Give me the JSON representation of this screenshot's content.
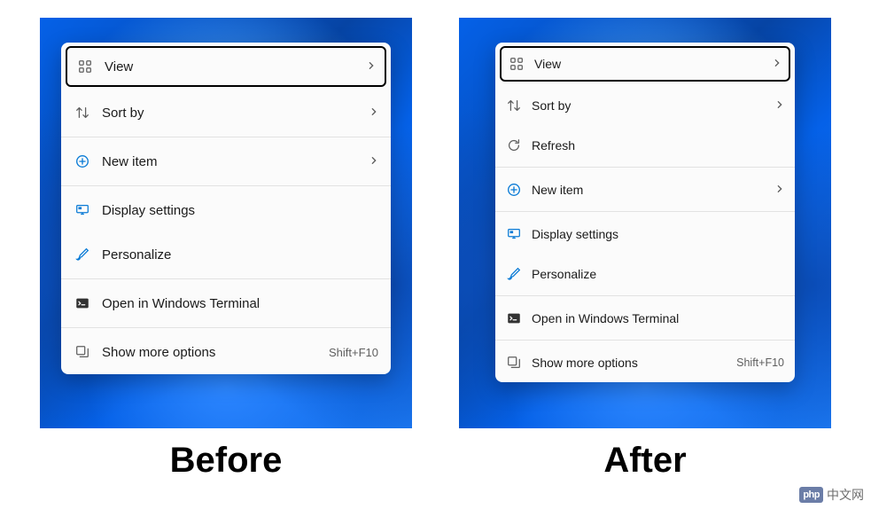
{
  "captions": {
    "before": "Before",
    "after": "After"
  },
  "shortcut": "Shift+F10",
  "before_menu": [
    {
      "type": "item",
      "icon": "grid",
      "label": "View",
      "chevron": true,
      "focused": true
    },
    {
      "type": "item",
      "icon": "sort",
      "label": "Sort by",
      "chevron": true
    },
    {
      "type": "sep"
    },
    {
      "type": "item",
      "icon": "new",
      "label": "New item",
      "chevron": true
    },
    {
      "type": "sep"
    },
    {
      "type": "item",
      "icon": "display",
      "label": "Display settings"
    },
    {
      "type": "item",
      "icon": "brush",
      "label": "Personalize"
    },
    {
      "type": "sep"
    },
    {
      "type": "item",
      "icon": "terminal",
      "label": "Open in Windows Terminal"
    },
    {
      "type": "sep"
    },
    {
      "type": "item",
      "icon": "more",
      "label": "Show more options",
      "shortcut": true
    }
  ],
  "after_menu": [
    {
      "type": "item",
      "icon": "grid",
      "label": "View",
      "chevron": true,
      "focused": true
    },
    {
      "type": "item",
      "icon": "sort",
      "label": "Sort by",
      "chevron": true
    },
    {
      "type": "item",
      "icon": "refresh",
      "label": "Refresh"
    },
    {
      "type": "sep"
    },
    {
      "type": "item",
      "icon": "new",
      "label": "New item",
      "chevron": true
    },
    {
      "type": "sep"
    },
    {
      "type": "item",
      "icon": "display",
      "label": "Display settings"
    },
    {
      "type": "item",
      "icon": "brush",
      "label": "Personalize"
    },
    {
      "type": "sep"
    },
    {
      "type": "item",
      "icon": "terminal",
      "label": "Open in Windows Terminal"
    },
    {
      "type": "sep"
    },
    {
      "type": "item",
      "icon": "more",
      "label": "Show more options",
      "shortcut": true
    }
  ],
  "watermark": {
    "badge": "php",
    "text": "中文网"
  }
}
